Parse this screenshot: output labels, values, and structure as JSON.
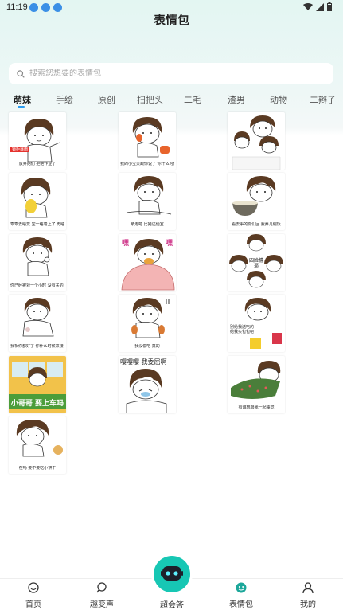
{
  "status_bar": {
    "time": "11:19"
  },
  "header": {
    "title": "表情包"
  },
  "search": {
    "placeholder": "搜索您想要的表情包"
  },
  "tabs": [
    {
      "label": "萌妹",
      "active": true
    },
    {
      "label": "手绘"
    },
    {
      "label": "原创"
    },
    {
      "label": "扫把头"
    },
    {
      "label": "二毛"
    },
    {
      "label": "渣男"
    },
    {
      "label": "动物"
    },
    {
      "label": "二辫子"
    }
  ],
  "stickers": [
    {
      "caption": "放弃她们 拒绝作业了",
      "badge": "锁柜暴雨",
      "icon": "girl-pointing-icon"
    },
    {
      "caption": "我的小宝贝跟你说了 你什么时候来接我呀？",
      "icon": "girl-on-phone-icon"
    },
    {
      "caption": "",
      "icon": "girls-crowd-icon"
    },
    {
      "caption": "乖乖去睡觉 宝一睡着上了 再睡睡觉宝宝",
      "icon": "girl-with-toy-icon"
    },
    {
      "caption": "拿走吧 比猪还便宜",
      "icon": "girl-sitting-icon"
    },
    {
      "caption": "看去事的你们回 我养几碗饭",
      "icon": "girl-with-bowl-icon"
    },
    {
      "caption": "你已经被对一个小时 没有关的小宝贝了",
      "icon": "girl-thinking-icon"
    },
    {
      "caption": "",
      "badge_left": "嘿",
      "badge_right": "嘿",
      "icon": "girl-eating-burger-icon"
    },
    {
      "caption": "",
      "badge": "四脸懵逼",
      "icon": "four-faces-icon"
    },
    {
      "caption": "我相你都好了 你什么时候来接我",
      "icon": "girl-waiting-icon"
    },
    {
      "caption": "我没偷吃 真的",
      "icon": "girl-hiding-food-icon"
    },
    {
      "caption": "别给我送吃的 给我买包包吧",
      "icon": "girl-with-bags-icon"
    },
    {
      "caption": "小哥哥 要上车吗",
      "icon": "girl-driving-bus-icon"
    },
    {
      "caption": "嘤嘤嘤 我委屈啊",
      "icon": "girl-crying-icon"
    },
    {
      "caption": "有谁想跟我一起睡觉",
      "icon": "girl-under-blanket-icon"
    },
    {
      "caption": "在吗 要不要吃小饼干",
      "icon": "girl-with-cookie-icon"
    }
  ],
  "nav": {
    "home": "首页",
    "voice": "趣变声",
    "center": "超会答",
    "stickers": "表情包",
    "me": "我的"
  },
  "colors": {
    "accent": "#17c7b4",
    "tab_indicator": "#2c9cf0"
  }
}
